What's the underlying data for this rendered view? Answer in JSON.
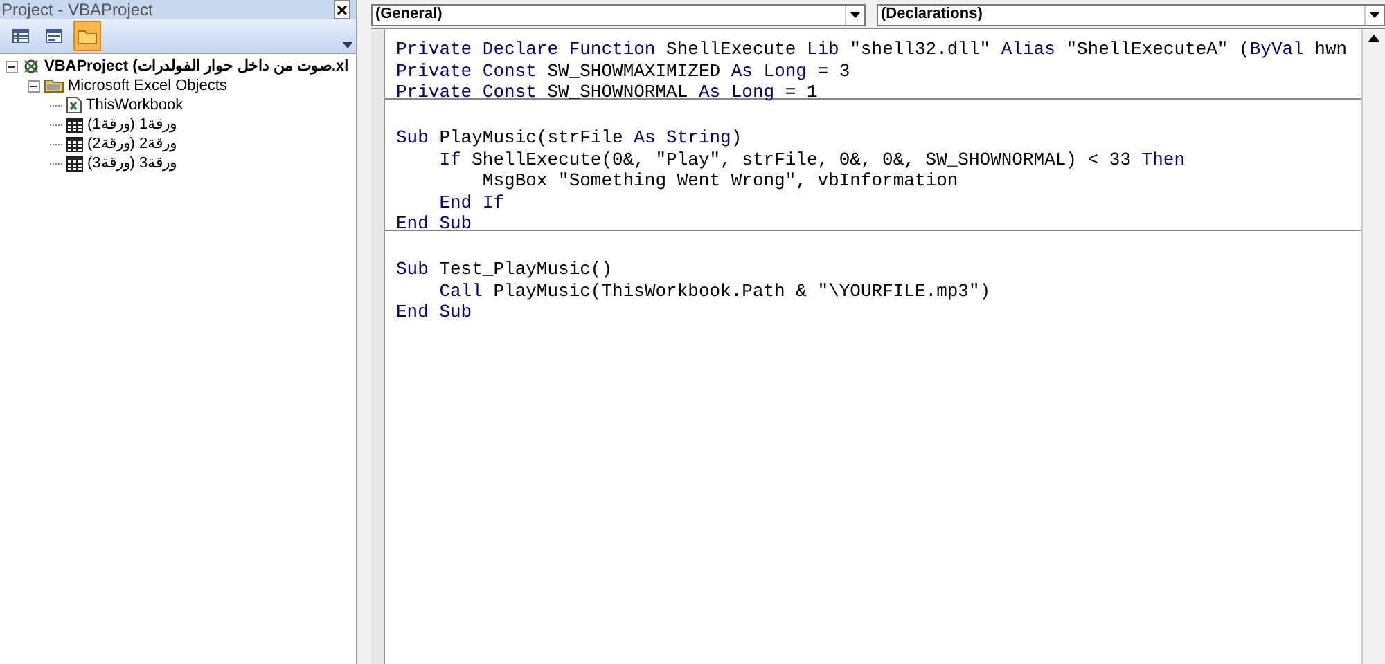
{
  "project_panel": {
    "title": "Project - VBAProject",
    "close": "×",
    "toolbar": [
      {
        "kind": "view-code",
        "selected": false
      },
      {
        "kind": "view-object",
        "selected": false
      },
      {
        "kind": "toggle-folders",
        "selected": true
      }
    ],
    "tree": [
      {
        "kind": "project",
        "label": "VBAProject (صوت من داخل حوار الفولدرات.xl",
        "expanded": true,
        "children": [
          {
            "kind": "folder",
            "label": "Microsoft Excel Objects",
            "expanded": true,
            "children": [
              {
                "kind": "workbook",
                "label": "ThisWorkbook"
              },
              {
                "kind": "sheet",
                "label": "ورقة1 (ورقة1)"
              },
              {
                "kind": "sheet",
                "label": "ورقة2 (ورقة2)"
              },
              {
                "kind": "sheet",
                "label": "ورقة3 (ورقة3)"
              }
            ]
          }
        ]
      }
    ]
  },
  "code_window": {
    "object_dropdown": "(General)",
    "procedure_dropdown": "(Declarations)",
    "procedures": [
      {
        "lines": [
          [
            {
              "kind": "keyword",
              "text": "Private Declare Function"
            },
            {
              "kind": "plain",
              "text": " ShellExecute "
            },
            {
              "kind": "keyword",
              "text": "Lib"
            },
            {
              "kind": "plain",
              "text": " \"shell32.dll\" "
            },
            {
              "kind": "keyword",
              "text": "Alias"
            },
            {
              "kind": "plain",
              "text": " \"ShellExecuteA\" ("
            },
            {
              "kind": "keyword",
              "text": "ByVal"
            },
            {
              "kind": "plain",
              "text": " hwn"
            }
          ],
          [
            {
              "kind": "keyword",
              "text": "Private Const"
            },
            {
              "kind": "plain",
              "text": " SW_SHOWMAXIMIZED "
            },
            {
              "kind": "keyword",
              "text": "As Long"
            },
            {
              "kind": "plain",
              "text": " = 3"
            }
          ],
          [
            {
              "kind": "keyword",
              "text": "Private Const"
            },
            {
              "kind": "plain",
              "text": " SW_SHOWNORMAL "
            },
            {
              "kind": "keyword",
              "text": "As Long"
            },
            {
              "kind": "plain",
              "text": " = 1"
            }
          ]
        ]
      },
      {
        "lines": [
          [
            {
              "kind": "keyword",
              "text": "Sub"
            },
            {
              "kind": "plain",
              "text": " PlayMusic(strFile "
            },
            {
              "kind": "keyword",
              "text": "As String"
            },
            {
              "kind": "plain",
              "text": ")"
            }
          ],
          [
            {
              "kind": "keyword",
              "text": "    If"
            },
            {
              "kind": "plain",
              "text": " ShellExecute(0&, \"Play\", strFile, 0&, 0&, SW_SHOWNORMAL) < 33 "
            },
            {
              "kind": "keyword",
              "text": "Then"
            }
          ],
          [
            {
              "kind": "plain",
              "text": "        MsgBox \"Something Went Wrong\", vbInformation"
            }
          ],
          [
            {
              "kind": "keyword",
              "text": "    End If"
            }
          ],
          [
            {
              "kind": "keyword",
              "text": "End Sub"
            }
          ]
        ]
      },
      {
        "lines": [
          [
            {
              "kind": "keyword",
              "text": "Sub"
            },
            {
              "kind": "plain",
              "text": " Test_PlayMusic()"
            }
          ],
          [
            {
              "kind": "keyword",
              "text": "    Call"
            },
            {
              "kind": "plain",
              "text": " PlayMusic(ThisWorkbook.Path & \"\\YOURFILE.mp3\")"
            }
          ],
          [
            {
              "kind": "keyword",
              "text": "End Sub"
            }
          ]
        ]
      }
    ]
  }
}
